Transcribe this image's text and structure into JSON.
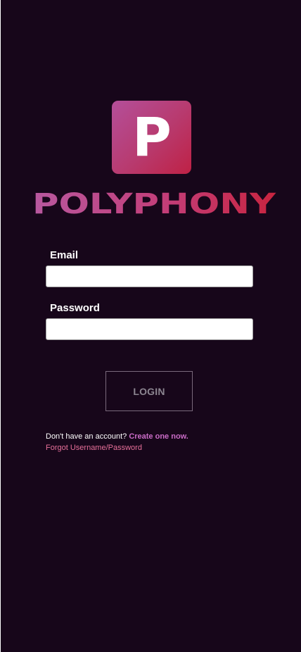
{
  "brand": {
    "logo_letter": "P",
    "name": "POLYPHONY",
    "colors": {
      "background": "#17061a",
      "gradient_start": "#b8589f",
      "gradient_end": "#c8243f"
    }
  },
  "form": {
    "email_label": "Email",
    "email_value": "",
    "password_label": "Password",
    "password_value": "",
    "login_label": "LOGIN"
  },
  "footer": {
    "signup_prompt": "Don't have an account?",
    "signup_link": "Create one now.",
    "forgot_link": "Forgot Username/Password"
  }
}
